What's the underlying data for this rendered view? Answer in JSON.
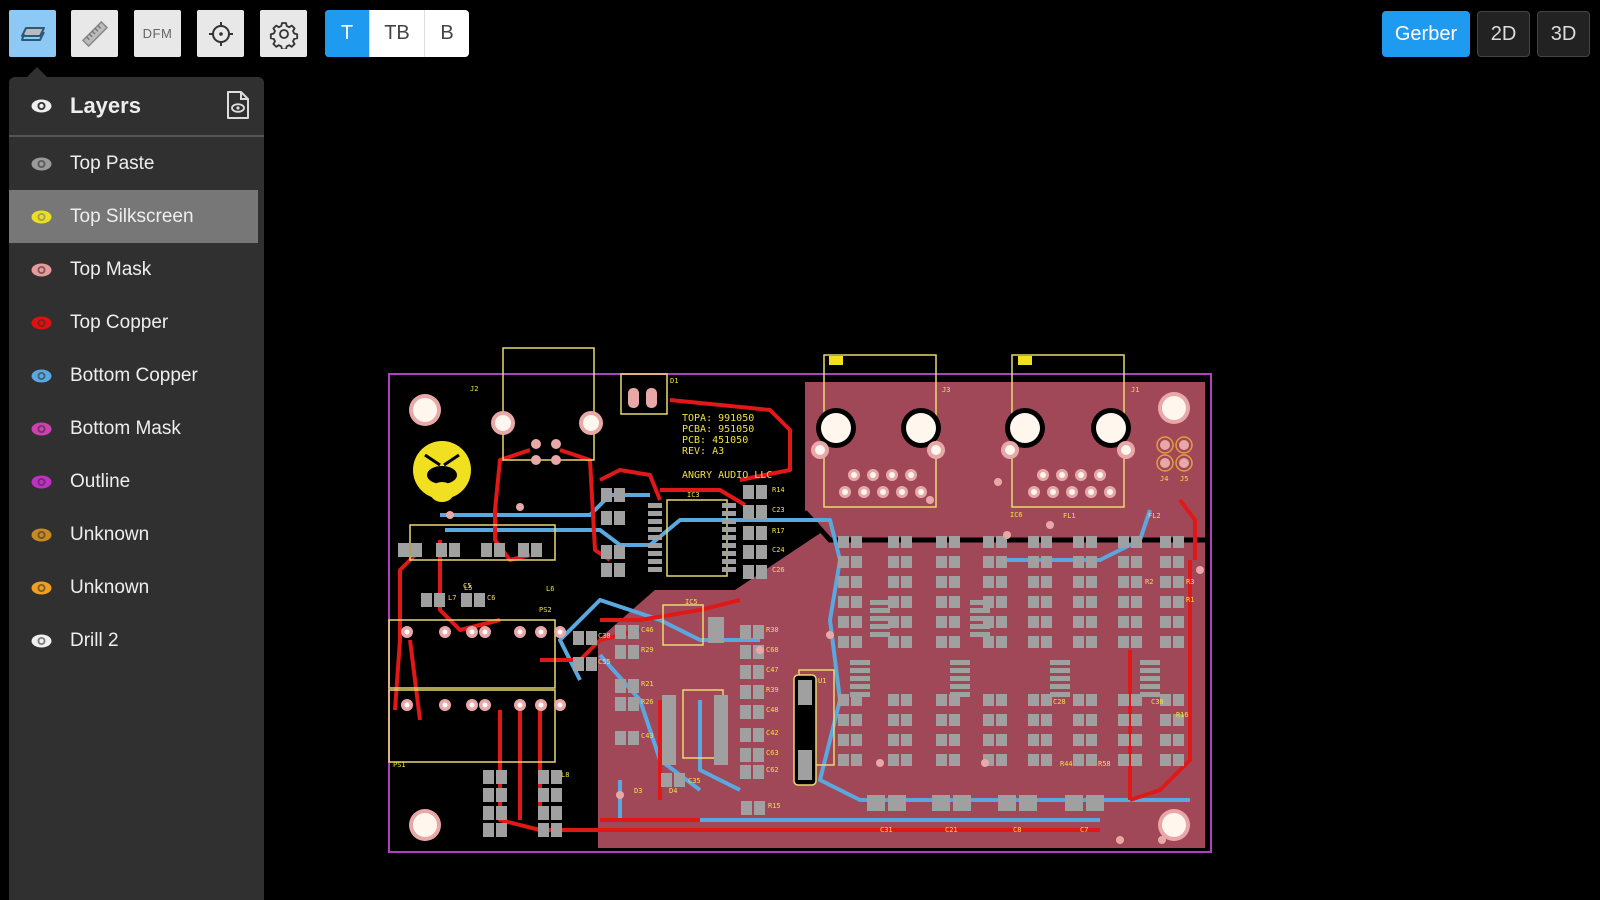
{
  "toolbar": {
    "tools": [
      {
        "name": "layers-tool",
        "icon": "layers-icon",
        "active": true
      },
      {
        "name": "measure-tool",
        "icon": "ruler-icon",
        "active": false
      },
      {
        "name": "dfm-tool",
        "label": "DFM",
        "active": false
      },
      {
        "name": "center-tool",
        "icon": "crosshair-icon",
        "active": false
      },
      {
        "name": "settings-tool",
        "icon": "gear-icon",
        "active": false
      }
    ],
    "side_toggle": {
      "options": [
        "T",
        "TB",
        "B"
      ],
      "selected": "T"
    },
    "view_modes": {
      "options": [
        "Gerber",
        "2D",
        "3D"
      ],
      "selected": "Gerber"
    }
  },
  "layers_panel": {
    "title": "Layers",
    "selected": "Top Silkscreen",
    "items": [
      {
        "label": "Top Paste",
        "color": "#9a9a9a"
      },
      {
        "label": "Top Silkscreen",
        "color": "#e8e020"
      },
      {
        "label": "Top Mask",
        "color": "#e89a9a"
      },
      {
        "label": "Top Copper",
        "color": "#e01010"
      },
      {
        "label": "Bottom Copper",
        "color": "#5aa8e0"
      },
      {
        "label": "Bottom Mask",
        "color": "#d040b0"
      },
      {
        "label": "Outline",
        "color": "#c030c8"
      },
      {
        "label": "Unknown",
        "color": "#c88a20"
      },
      {
        "label": "Unknown",
        "color": "#f0a020"
      },
      {
        "label": "Drill 2",
        "color": "#f0f0f0"
      }
    ]
  },
  "board": {
    "colors": {
      "outline": "#b040c0",
      "silkscreen": "#e8d870",
      "silk_text": "#f0e040",
      "top_copper": "#e01818",
      "bottom_copper": "#5aa8e0",
      "pour": "#a04858",
      "pad": "#a0a0a0",
      "drill": "#fff6ee",
      "annular": "#e8a8a8"
    },
    "text": {
      "part_info": [
        "TOPA: 991050",
        "PCBA: 951050",
        "PCB: 451050",
        "REV: A3"
      ],
      "company": "ANGRY AUDIO LLC"
    },
    "refdes": [
      "J2",
      "D1",
      "J3",
      "J1",
      "J4",
      "J5",
      "IC3",
      "IC5",
      "IC6",
      "R14",
      "C23",
      "R17",
      "C24",
      "C26",
      "PS2",
      "PS1",
      "L5",
      "L6",
      "L7",
      "L8",
      "C5",
      "C6",
      "C38",
      "C55",
      "C46",
      "R29",
      "R21",
      "R26",
      "C43",
      "C35",
      "D3",
      "D4",
      "R15",
      "R30",
      "C68",
      "C47",
      "R39",
      "C48",
      "C42",
      "C63",
      "C62",
      "C31",
      "C21",
      "C8",
      "C7",
      "FL1",
      "FL2",
      "U1",
      "R44",
      "R58",
      "R16",
      "C28",
      "C36",
      "R1",
      "R2",
      "R3"
    ]
  }
}
